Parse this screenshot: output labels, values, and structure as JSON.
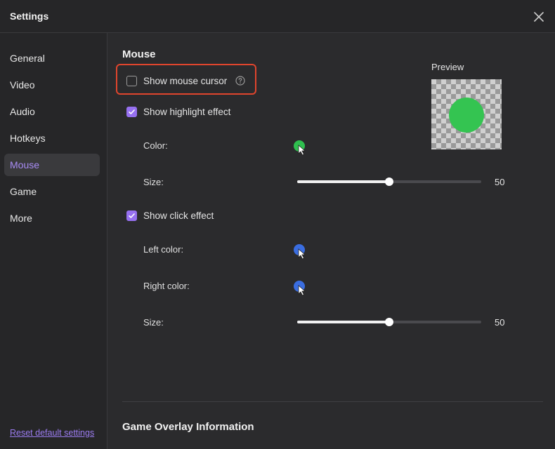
{
  "window": {
    "title": "Settings"
  },
  "sidebar": {
    "items": [
      {
        "label": "General",
        "active": false
      },
      {
        "label": "Video",
        "active": false
      },
      {
        "label": "Audio",
        "active": false
      },
      {
        "label": "Hotkeys",
        "active": false
      },
      {
        "label": "Mouse",
        "active": true
      },
      {
        "label": "Game",
        "active": false
      },
      {
        "label": "More",
        "active": false
      }
    ],
    "reset_label": "Reset default settings"
  },
  "mouse": {
    "title": "Mouse",
    "show_cursor": {
      "label": "Show mouse cursor",
      "checked": false
    },
    "highlight": {
      "label": "Show highlight effect",
      "checked": true,
      "color_label": "Color:",
      "color": "#2fbf4f",
      "size_label": "Size:",
      "size_value": "50",
      "size_fraction": 0.5
    },
    "click": {
      "label": "Show click effect",
      "checked": true,
      "left_color_label": "Left color:",
      "left_color": "#3a6de0",
      "right_color_label": "Right color:",
      "right_color": "#3a6de0",
      "size_label": "Size:",
      "size_value": "50",
      "size_fraction": 0.5
    },
    "preview": {
      "label": "Preview",
      "dot_color": "#34c451"
    }
  },
  "game_overlay": {
    "title": "Game Overlay Information"
  },
  "theme": {
    "accent": "#9670f0",
    "highlight_border": "#e0452d"
  }
}
